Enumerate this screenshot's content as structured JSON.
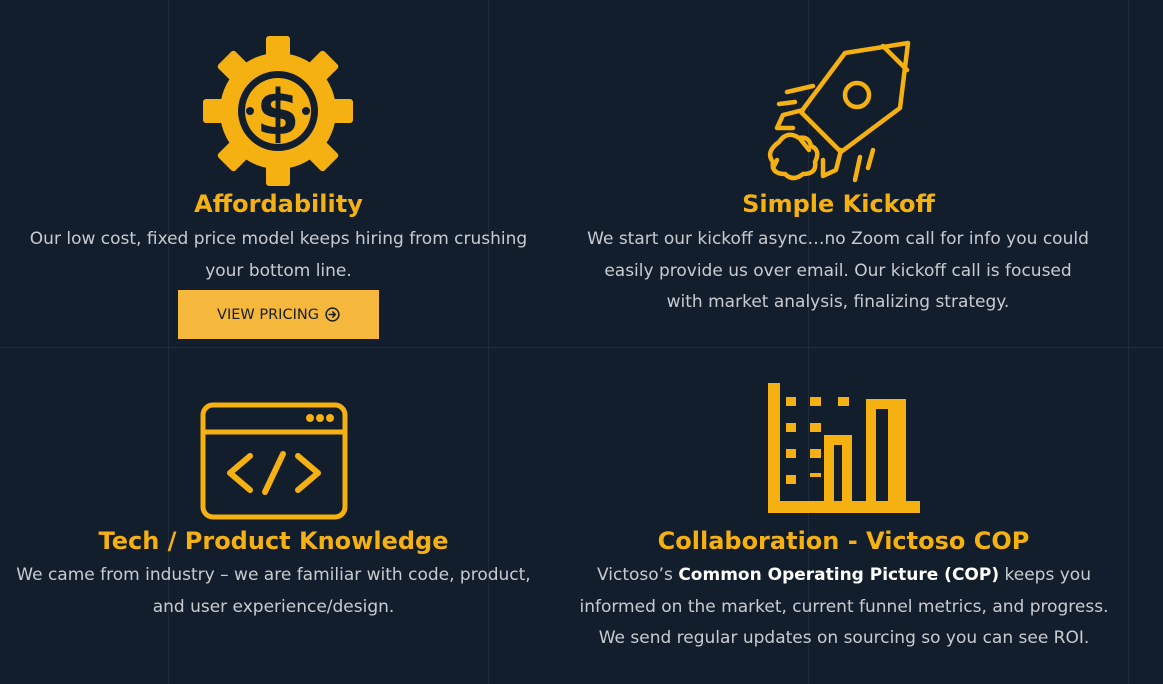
{
  "colors": {
    "accent": "#f5b012",
    "background": "#131e2c",
    "button": "#f5b83d"
  },
  "features": [
    {
      "icon": "dollar-gear-icon",
      "title": "Affordability",
      "description": "Our low cost, fixed price model keeps hiring from crushing your bottom line.",
      "button": {
        "label": "VIEW PRICING",
        "icon": "arrow-circle-right-icon"
      }
    },
    {
      "icon": "rocket-icon",
      "title": "Simple Kickoff",
      "description": "We start our kickoff async…no Zoom call for info you could easily provide us over email. Our kickoff call is focused with market analysis, finalizing strategy."
    },
    {
      "icon": "code-window-icon",
      "title": "Tech / Product Knowledge",
      "description": "We came from industry – we are familiar with code, product, and user experience/design."
    },
    {
      "icon": "bar-chart-icon",
      "title": "Collaboration - Victoso COP",
      "description_pre": "Victoso’s ",
      "description_bold": "Common Operating Picture (COP)",
      "description_post": " keeps you informed on the market, current funnel metrics, and progress. We send regular updates on sourcing so you can see ROI."
    }
  ]
}
